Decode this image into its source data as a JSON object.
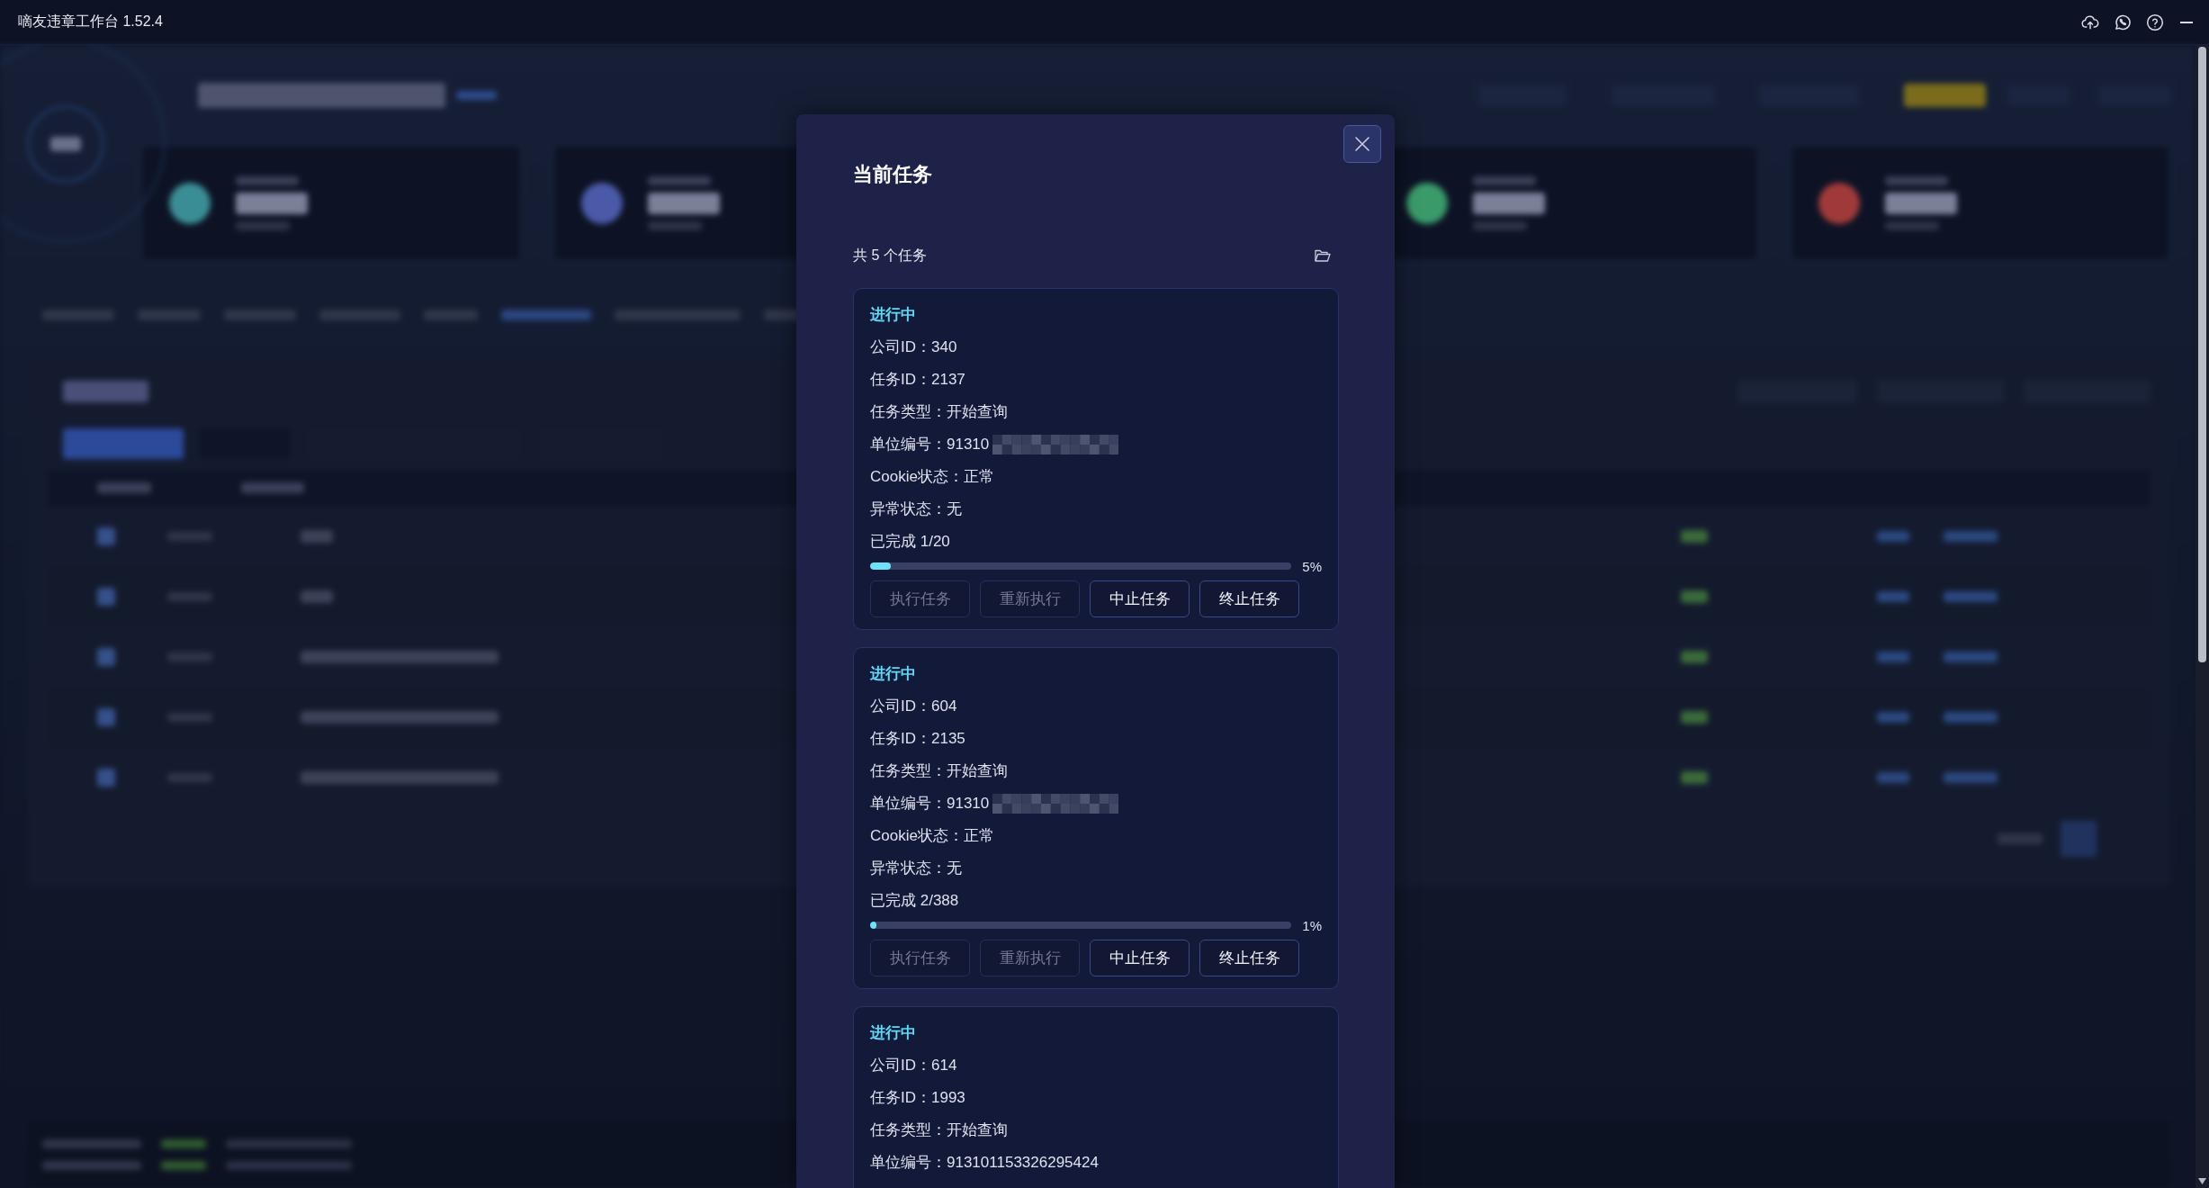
{
  "title_bar": {
    "title": "嘀友违章工作台 1.52.4"
  },
  "dialog": {
    "title": "当前任务",
    "task_count": "共 5 个任务",
    "tasks": [
      {
        "status": "进行中",
        "fields": [
          {
            "text": "公司ID：340",
            "redacted": false
          },
          {
            "text": "任务ID：2137",
            "redacted": false
          },
          {
            "text": "任务类型：开始查询",
            "redacted": false
          },
          {
            "text": "单位编号：91310",
            "redacted": true
          },
          {
            "text": "Cookie状态：正常",
            "redacted": false
          },
          {
            "text": "异常状态：无",
            "redacted": false
          }
        ],
        "progress": {
          "text": "已完成 1/20",
          "level": 0.05,
          "percent": "5%"
        },
        "buttons": [
          {
            "label": "执行任务",
            "disabled": true
          },
          {
            "label": "重新执行",
            "disabled": true
          },
          {
            "label": "中止任务",
            "disabled": false
          },
          {
            "label": "终止任务",
            "disabled": false
          }
        ]
      },
      {
        "status": "进行中",
        "fields": [
          {
            "text": "公司ID：604",
            "redacted": false
          },
          {
            "text": "任务ID：2135",
            "redacted": false
          },
          {
            "text": "任务类型：开始查询",
            "redacted": false
          },
          {
            "text": "单位编号：91310",
            "redacted": true
          },
          {
            "text": "Cookie状态：正常",
            "redacted": false
          },
          {
            "text": "异常状态：无",
            "redacted": false
          }
        ],
        "progress": {
          "text": "已完成 2/388",
          "level": 0.01,
          "percent": "1%"
        },
        "buttons": [
          {
            "label": "执行任务",
            "disabled": true
          },
          {
            "label": "重新执行",
            "disabled": true
          },
          {
            "label": "中止任务",
            "disabled": false
          },
          {
            "label": "终止任务",
            "disabled": false
          }
        ]
      },
      {
        "status": "进行中",
        "fields": [
          {
            "text": "公司ID：614",
            "redacted": false
          },
          {
            "text": "任务ID：1993",
            "redacted": false
          },
          {
            "text": "任务类型：开始查询",
            "redacted": false
          },
          {
            "text": "单位编号：913101153326295424",
            "redacted": false
          }
        ]
      }
    ]
  }
}
